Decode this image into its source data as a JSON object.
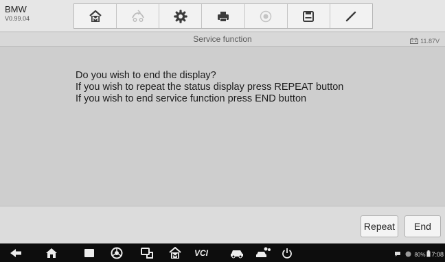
{
  "header": {
    "vehicle": "BMW",
    "version": "V0.99.04"
  },
  "toolbar": {
    "buttons": [
      {
        "icon": "home-icon"
      },
      {
        "icon": "vehicle-swap-icon"
      },
      {
        "icon": "settings-gear-icon"
      },
      {
        "icon": "print-icon"
      },
      {
        "icon": "help-icon"
      },
      {
        "icon": "save-icon"
      },
      {
        "icon": "edit-pen-icon"
      }
    ]
  },
  "title_bar": {
    "title": "Service function",
    "battery_voltage": "11.87V"
  },
  "message": {
    "lines": [
      "Do you wish to end the display?",
      "If you wish to repeat the status display press REPEAT button",
      "If you wish to end service function press END button"
    ]
  },
  "actions": {
    "repeat_label": "Repeat",
    "end_label": "End"
  },
  "system_bar": {
    "vcl_label": "VCI",
    "battery_percent": "80%",
    "time": "7:08",
    "icons": [
      "back-icon",
      "home-icon",
      "recent-apps-icon",
      "browser-icon",
      "remote-icon",
      "maxisys-home-icon",
      "vci-icon",
      "car-icon",
      "car-people-icon",
      "power-icon"
    ]
  },
  "colors": {
    "toolbar_bg": "#f2f2f2",
    "content_bg": "#cecece",
    "nav_bg": "#0d0d0d"
  }
}
